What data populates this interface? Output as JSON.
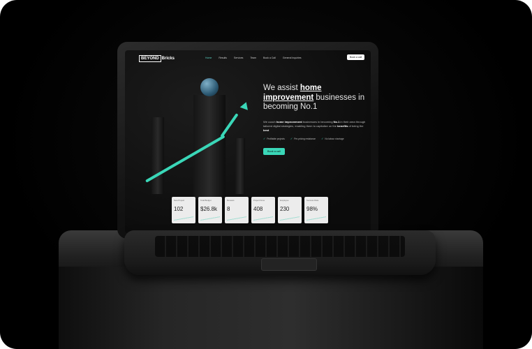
{
  "header": {
    "logo_boxed": "BEYOND",
    "logo_rest": "Bricks",
    "nav": [
      "Home",
      "Results",
      "Services",
      "Team",
      "Book a Call",
      "General Inquiries"
    ],
    "book_label": "Book a call"
  },
  "hero": {
    "headline_pre": "We assist ",
    "headline_bold": "home improvement",
    "headline_post": " businesses in becoming No.1",
    "sub_pre": "We coach ",
    "sub_bold1": "home improvement",
    "sub_mid": " businesses in becoming ",
    "sub_bold2": "No.1",
    "sub_post": " in their area through tailored digital strategies, enabling them to capitalize on the ",
    "sub_bold3": "benefits",
    "sub_end": " of being the ",
    "sub_bold4": "best",
    "checks": [
      "Profitable projects",
      "Pre-pricing resistance",
      "No labour shortage"
    ],
    "cta_label": "Book a call"
  },
  "stats": [
    {
      "label": "New Project",
      "value": "102"
    },
    {
      "label": "Total Budget",
      "value": "$26.8k"
    },
    {
      "label": "Reviews",
      "value": "8"
    },
    {
      "label": "Project Done",
      "value": "408"
    },
    {
      "label": "Employee",
      "value": "230"
    },
    {
      "label": "Success Rate",
      "value": "98%"
    }
  ],
  "colors": {
    "accent": "#3ad7b8",
    "background": "#000000"
  }
}
